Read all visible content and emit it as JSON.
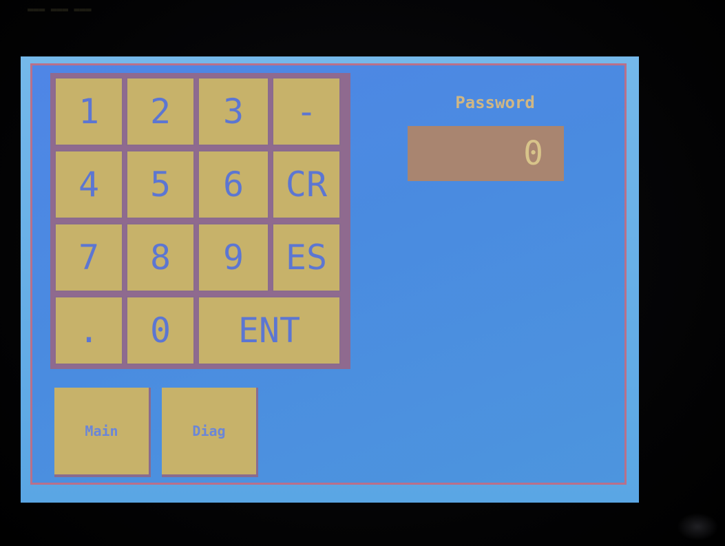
{
  "bezel": {
    "top_label": "▬▬▬ ▬▬▬ ▬▬▬"
  },
  "keypad": {
    "rows": [
      [
        "1",
        "2",
        "3",
        "-"
      ],
      [
        "4",
        "5",
        "6",
        "CR"
      ],
      [
        "7",
        "8",
        "9",
        "ES"
      ],
      [
        ".",
        "0",
        "ENT"
      ]
    ]
  },
  "password": {
    "label": "Password",
    "value": "0"
  },
  "nav": {
    "main_label": "Main",
    "diag_label": "Diag"
  },
  "colors": {
    "panel_blue": "#4f86e6",
    "key_tan": "#c7b26a",
    "key_text": "#5c76d2",
    "field_bg": "#a98570",
    "border_pink": "#b9708a"
  }
}
